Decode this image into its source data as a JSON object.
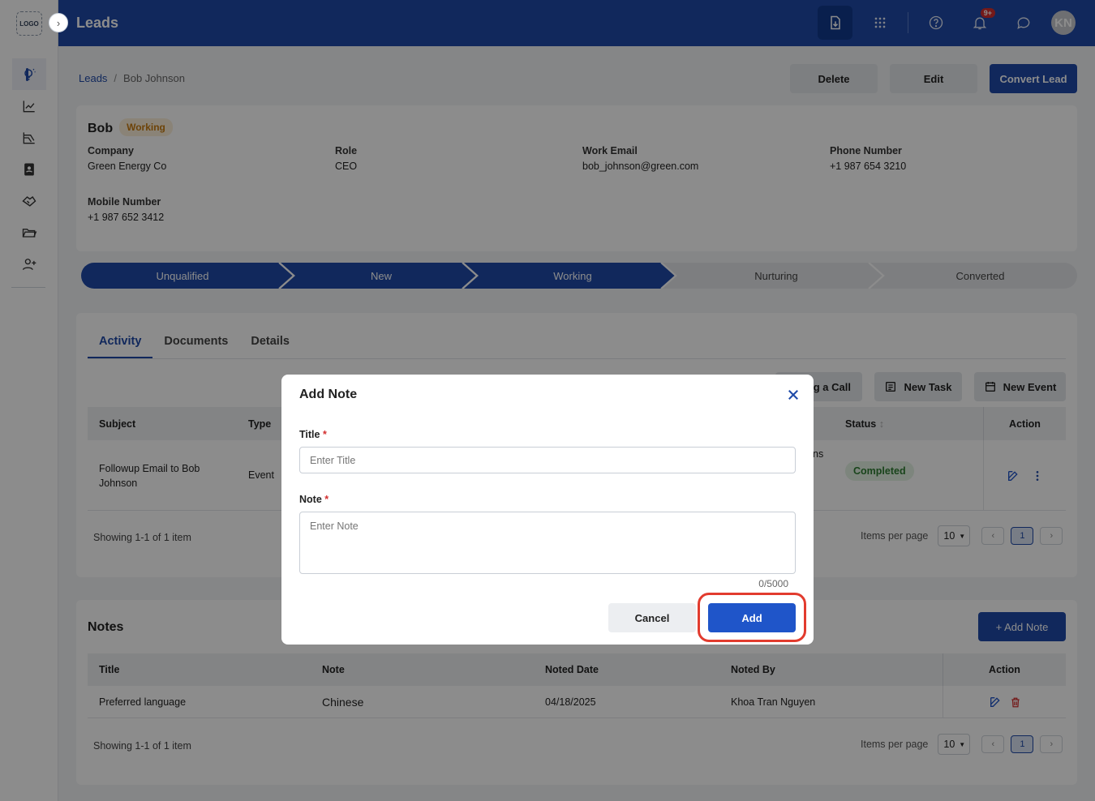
{
  "app": {
    "logo_text": "LOGO",
    "page_title": "Leads"
  },
  "topbar": {
    "notification_badge": "9+",
    "avatar_initials": "KN"
  },
  "breadcrumb": {
    "root": "Leads",
    "separator": "/",
    "current": "Bob Johnson"
  },
  "header_actions": {
    "delete": "Delete",
    "edit": "Edit",
    "convert": "Convert Lead"
  },
  "lead": {
    "name": "Bob",
    "status": "Working",
    "fields": [
      {
        "label": "Company",
        "value": "Green Energy Co"
      },
      {
        "label": "Role",
        "value": "CEO"
      },
      {
        "label": "Work Email",
        "value": "bob_johnson@green.com"
      },
      {
        "label": "Phone Number",
        "value": "+1 987 654 3210"
      },
      {
        "label": "Mobile Number",
        "value": "+1 987 652 3412"
      }
    ]
  },
  "stages": [
    "Unqualified",
    "New",
    "Working",
    "Nurturing",
    "Converted"
  ],
  "tabs": [
    "Activity",
    "Documents",
    "Details"
  ],
  "activity": {
    "toolbar": {
      "log_call": "og a Call",
      "new_task": "New Task",
      "new_event": "New Event"
    },
    "columns": {
      "subject": "Subject",
      "type": "Type",
      "status": "Status",
      "action": "Action"
    },
    "row": {
      "subject": "Followup Email to Bob Johnson",
      "type": "Event",
      "partial": "ns",
      "status": "Completed"
    },
    "footer": "Showing 1-1 of 1 item",
    "items_per_page_label": "Items per page",
    "items_per_page": "10",
    "page": "1"
  },
  "notes": {
    "heading": "Notes",
    "add_button": "+ Add Note",
    "columns": {
      "title": "Title",
      "note": "Note",
      "noted_date": "Noted Date",
      "noted_by": "Noted By",
      "action": "Action"
    },
    "row": {
      "title": "Preferred language",
      "note": "Chinese",
      "noted_date": "04/18/2025",
      "noted_by": "Khoa Tran Nguyen"
    },
    "footer": "Showing 1-1 of 1 item",
    "items_per_page_label": "Items per page",
    "items_per_page": "10",
    "page": "1"
  },
  "modal": {
    "title": "Add Note",
    "title_label": "Title",
    "title_placeholder": "Enter Title",
    "note_label": "Note",
    "note_placeholder": "Enter Note",
    "required_mark": "*",
    "counter": "0/5000",
    "cancel": "Cancel",
    "add": "Add"
  },
  "colors": {
    "primary": "#1f4aa8",
    "highlight": "#e23b2e",
    "warning": "#c77b10",
    "success": "#2e7d32"
  }
}
